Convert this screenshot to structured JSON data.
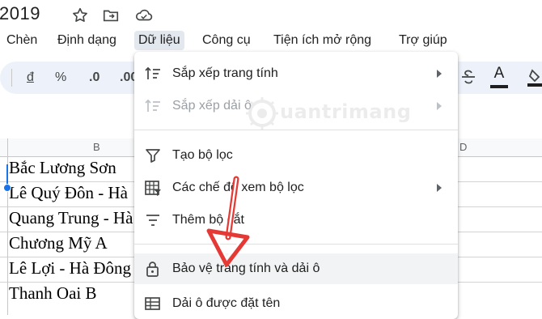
{
  "title_bar": {
    "doc_title": "2019",
    "icons": [
      "star-icon",
      "move-to-folder-icon",
      "cloud-status-icon"
    ]
  },
  "menubar": {
    "items": [
      {
        "label": "Chèn"
      },
      {
        "label": "Định dạng"
      },
      {
        "label": "Dữ liệu",
        "active": true
      },
      {
        "label": "Công cụ"
      },
      {
        "label": "Tiện ích mở rộng"
      },
      {
        "label": "Trợ giúp"
      }
    ]
  },
  "toolbar": {
    "currency_label": "đ",
    "percent_label": "%",
    "decrease_decimals_label": ".0",
    "increase_decimals_label": ".00",
    "text_color_label": "A",
    "icons": [
      "strikethrough-icon",
      "text-color-icon",
      "fill-color-icon"
    ]
  },
  "grid": {
    "columns": [
      "B",
      "D"
    ],
    "rows": [
      "Bắc Lương Sơn",
      "Lê Quý Đôn - Hà",
      "Quang Trung - Hà",
      "Chương Mỹ A",
      "Lê Lợi - Hà Đông",
      "Thanh Oai B"
    ]
  },
  "data_menu": {
    "items": [
      {
        "label": "Sắp xếp trang tính",
        "icon": "sort-icon",
        "submenu": true,
        "disabled": false
      },
      {
        "label": "Sắp xếp dải ô",
        "icon": "sort-range-icon",
        "submenu": true,
        "disabled": true
      },
      {
        "label": "Tạo bộ lọc",
        "icon": "filter-icon",
        "submenu": false,
        "disabled": false
      },
      {
        "label": "Các chế độ xem bộ lọc",
        "icon": "filter-views-icon",
        "submenu": true,
        "disabled": false
      },
      {
        "label": "Thêm bộ cắt",
        "icon": "slicer-icon",
        "submenu": false,
        "disabled": false
      },
      {
        "label": "Bảo vệ trang tính và dải ô",
        "icon": "lock-icon",
        "submenu": false,
        "disabled": false,
        "highlighted": true
      },
      {
        "label": "Dải ô được đặt tên",
        "icon": "named-range-icon",
        "submenu": false,
        "disabled": false
      }
    ]
  },
  "watermark": {
    "text": "uantrimang"
  },
  "colors": {
    "accent": "#1a73e8",
    "arrow": "#e53935",
    "toolbar_bg": "#edf2fa",
    "menu_active_bg": "#e3e8ef"
  }
}
